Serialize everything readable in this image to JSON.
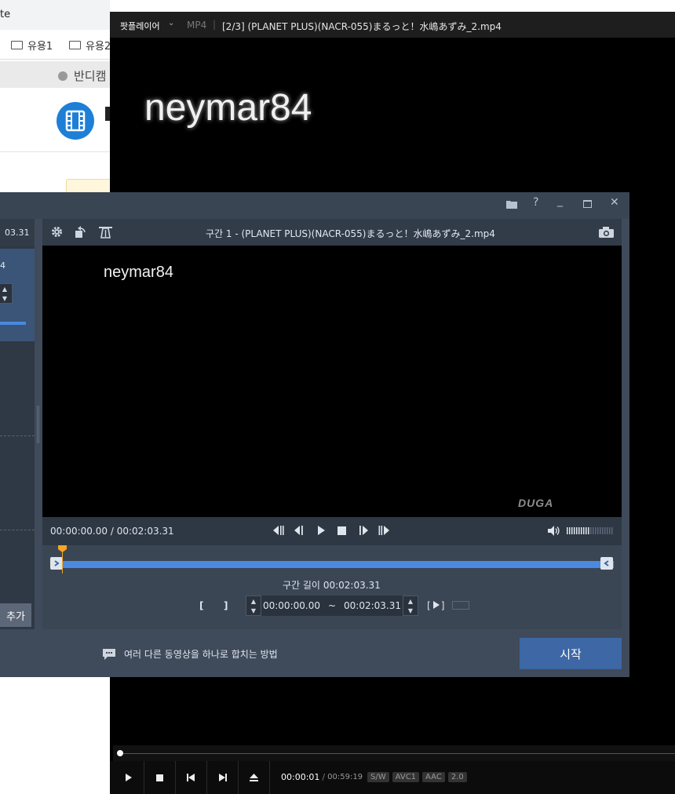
{
  "browser": {
    "tab_title_fragment": "te",
    "bookmarks": [
      "유용1",
      "유용2"
    ],
    "nav_item": "반디캠"
  },
  "potplayer": {
    "app_label": "팟플레이어",
    "format": "MP4",
    "file_title": "[2/3] (PLANET PLUS)(NACR-055)まるっと！水嶋あずみ_2.mp4",
    "overlay_text": "neymar84",
    "current_time": "00:00:01",
    "total_time": "00:59:19",
    "tags": [
      "S/W",
      "AVC1",
      "AAC",
      "2.0"
    ]
  },
  "bandicut": {
    "left_panel": {
      "time_fragment": "03.31",
      "item_fragment": "4",
      "add_button": "추가"
    },
    "file_header": "구간 1 - (PLANET PLUS)(NACR-055)まるっと！水嶋あずみ_2.mp4",
    "video_overlay_text": "neymar84",
    "watermark": "DUGA",
    "time_display": {
      "current": "00:00:00.00",
      "separator": "/",
      "total": "00:02:03.31"
    },
    "segment_length_label": "구간 길이",
    "segment_length_value": "00:02:03.31",
    "range": {
      "start": "00:00:00.00",
      "tilde": "~",
      "end": "00:02:03.31"
    },
    "tip_text": "여러 다른 동영상을 하나로 합치는 방법",
    "start_button": "시작",
    "colors": {
      "accent": "#4a8ae0",
      "marker": "#f5a623",
      "start_button": "#3d67a5"
    }
  }
}
